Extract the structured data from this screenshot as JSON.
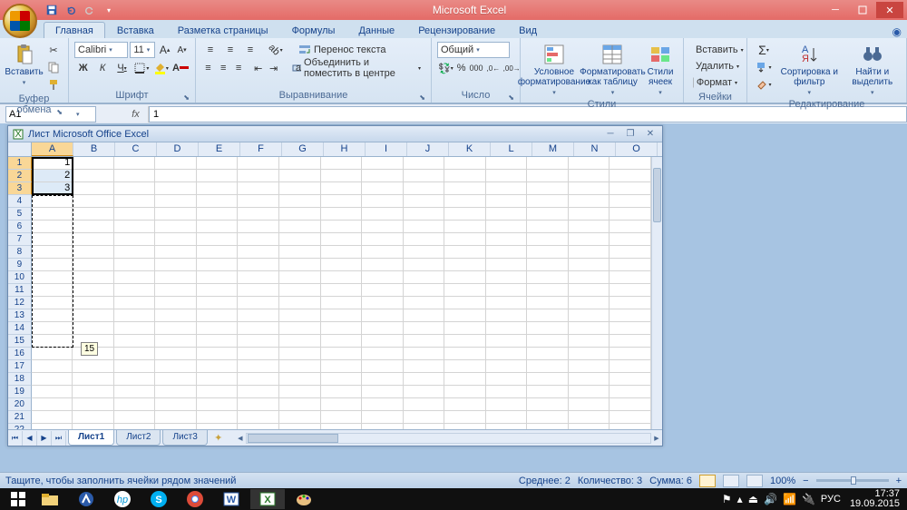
{
  "app_title": "Microsoft Excel",
  "tabs": {
    "home": "Главная",
    "insert": "Вставка",
    "layout": "Разметка страницы",
    "formulas": "Формулы",
    "data": "Данные",
    "review": "Рецензирование",
    "view": "Вид"
  },
  "ribbon": {
    "clipboard": {
      "label": "Буфер обмена",
      "paste": "Вставить"
    },
    "font": {
      "label": "Шрифт",
      "name": "Calibri",
      "size": "11"
    },
    "align": {
      "label": "Выравнивание",
      "wrap": "Перенос текста",
      "merge": "Объединить и поместить в центре"
    },
    "number": {
      "label": "Число",
      "format": "Общий"
    },
    "styles": {
      "label": "Стили",
      "cond": "Условное форматирование",
      "table": "Форматировать как таблицу",
      "cell": "Стили ячеек"
    },
    "cells": {
      "label": "Ячейки",
      "insert": "Вставить",
      "delete": "Удалить",
      "format": "Формат"
    },
    "editing": {
      "label": "Редактирование",
      "sort": "Сортировка и фильтр",
      "find": "Найти и выделить"
    }
  },
  "namebox": "A1",
  "formula": "1",
  "inner_window_title": "Лист Microsoft Office Excel",
  "columns": [
    "A",
    "B",
    "C",
    "D",
    "E",
    "F",
    "G",
    "H",
    "I",
    "J",
    "K",
    "L",
    "M",
    "N",
    "O"
  ],
  "row_count": 22,
  "selected_rows": [
    1,
    2,
    3
  ],
  "cells": {
    "A1": "1",
    "A2": "2",
    "A3": "3"
  },
  "fill_tooltip": "15",
  "sheets": [
    "Лист1",
    "Лист2",
    "Лист3"
  ],
  "active_sheet": 0,
  "status_msg": "Тащите, чтобы заполнить ячейки рядом значений",
  "status_calc": {
    "avg_label": "Среднее:",
    "avg": "2",
    "count_label": "Количество:",
    "count": "3",
    "sum_label": "Сумма:",
    "sum": "6"
  },
  "zoom": "100%",
  "taskbar": {
    "lang": "РУС",
    "time": "17:37",
    "date": "19.09.2015"
  }
}
